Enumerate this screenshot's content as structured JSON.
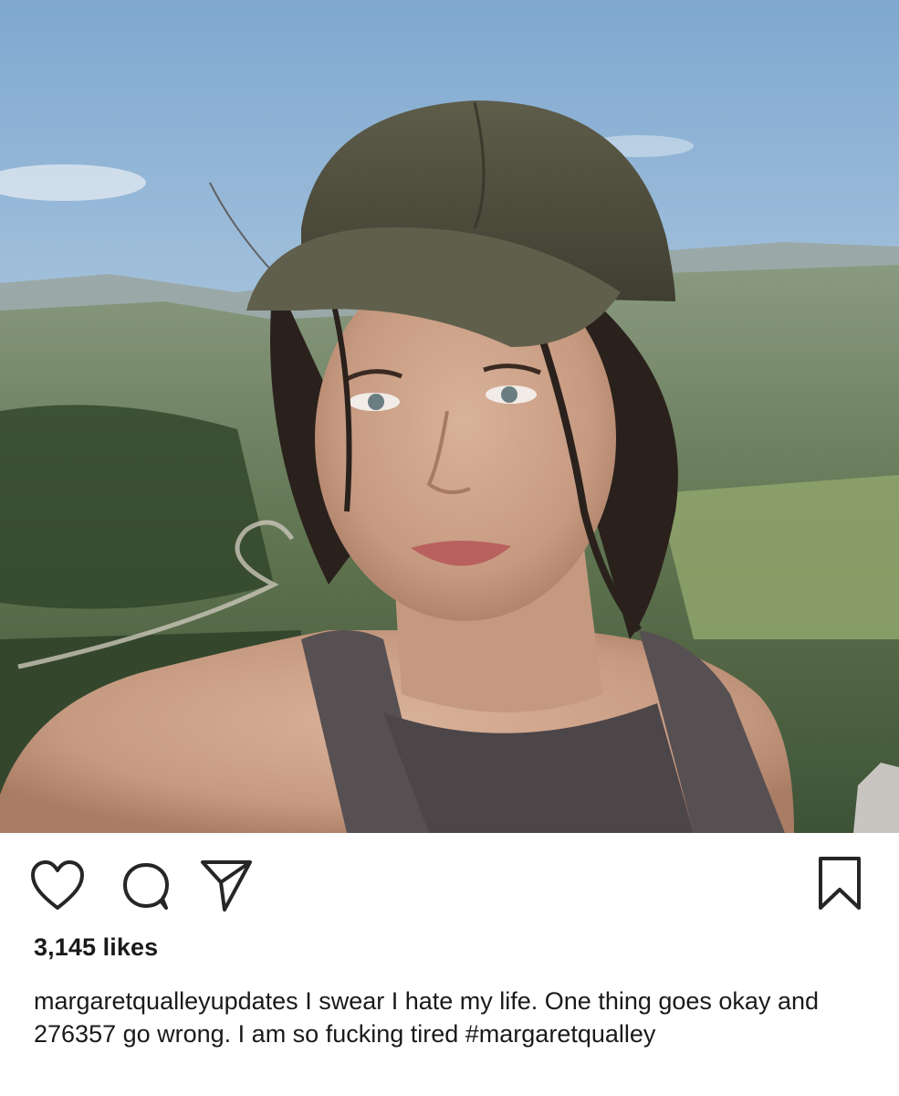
{
  "post": {
    "likes_text": "3,145 likes",
    "username": "margaretqualleyupdates",
    "caption_text": " I swear I hate my life. One thing goes okay and 276357 go wrong. I am so fucking tired ",
    "hashtag": "#margaretqualley"
  },
  "icons": {
    "like": "heart-icon",
    "comment": "comment-bubble-icon",
    "share": "paper-plane-icon",
    "save": "bookmark-icon"
  },
  "colors": {
    "text": "#1a1a1a",
    "icon_stroke": "#262626",
    "background": "#ffffff"
  }
}
